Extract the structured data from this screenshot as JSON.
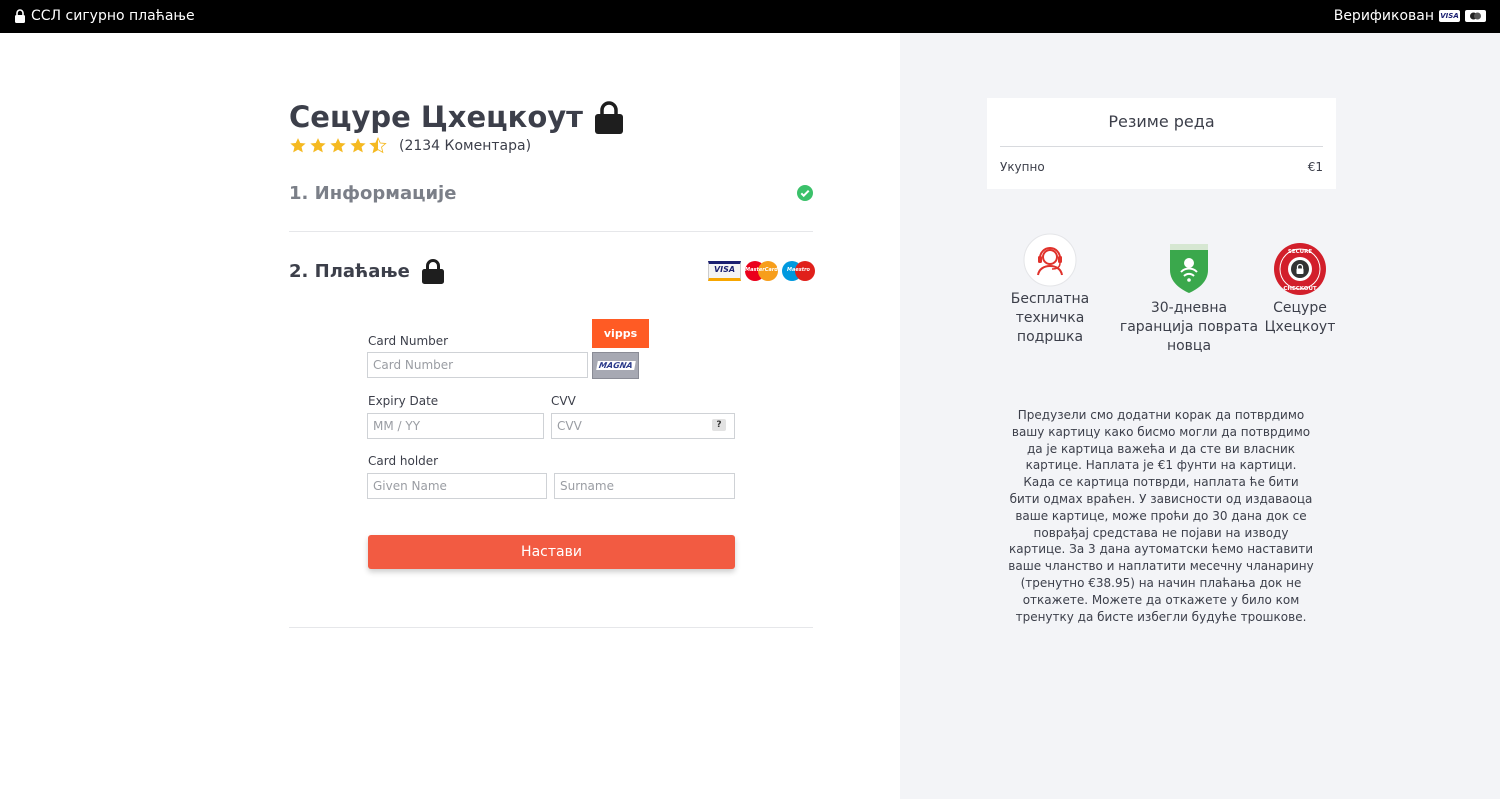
{
  "topbar": {
    "ssl_text": "ССЛ сигурно плаћање",
    "verified_text": "Верификован",
    "visa_mini": "VISA"
  },
  "checkout": {
    "title": "Сецуре Цхецкоут",
    "rating_stars": 4.5,
    "rating_count": "(2134 Коментара)",
    "step1": "1. Информације",
    "step2": "2. Плаћање",
    "card_logos": {
      "visa": "VISA",
      "mastercard": "MasterCard",
      "maestro": "Maestro"
    }
  },
  "form": {
    "card_number_label": "Card Number",
    "card_number_placeholder": "Card Number",
    "expiry_label": "Expiry Date",
    "expiry_placeholder": "MM / YY",
    "cvv_label": "CVV",
    "cvv_placeholder": "CVV",
    "cvv_help": "?",
    "holder_label": "Card holder",
    "given_placeholder": "Given Name",
    "surname_placeholder": "Surname",
    "vipps_label": "vipps",
    "magna_label": "MAGNA",
    "continue_label": "Настави"
  },
  "summary": {
    "title": "Резиме реда",
    "total_label": "Укупно",
    "total_value": "€1"
  },
  "features": [
    {
      "label": "Бесплатна техничка подршка",
      "icon": "support-headset-icon"
    },
    {
      "label": "30-дневна гаранција поврата новца",
      "icon": "shield-icon"
    },
    {
      "label": "Сецуре Цхецкоут",
      "icon": "secure-checkout-badge-icon",
      "badge_top": "SECURE",
      "badge_bottom": "CHECKOUT"
    }
  ],
  "disclaimer": "Предузели смо додатни корак да потврдимо вашу картицу како бисмо могли да потврдимо да је картица важећа и да сте ви власник картице. Наплата је €1 фунти на картици. Када се картица потврди, наплата ће бити бити одмах враћен. У зависности од издаваоца ваше картице, може проћи до 30 дана док се поврађај средстава не појави на изводу картице. За 3 дана аутоматски ћемо наставити ваше чланство и наплатити месечну чланарину (тренутно €38.95) на начин плаћања док не откажете. Можете да откажете у било ком тренутку да бисте избегли будуће трошкове.",
  "colors": {
    "accent": "#f25b42",
    "star": "#f5b921",
    "check": "#3bc16a",
    "topbar": "#000000",
    "panel": "#f3f4f7"
  }
}
